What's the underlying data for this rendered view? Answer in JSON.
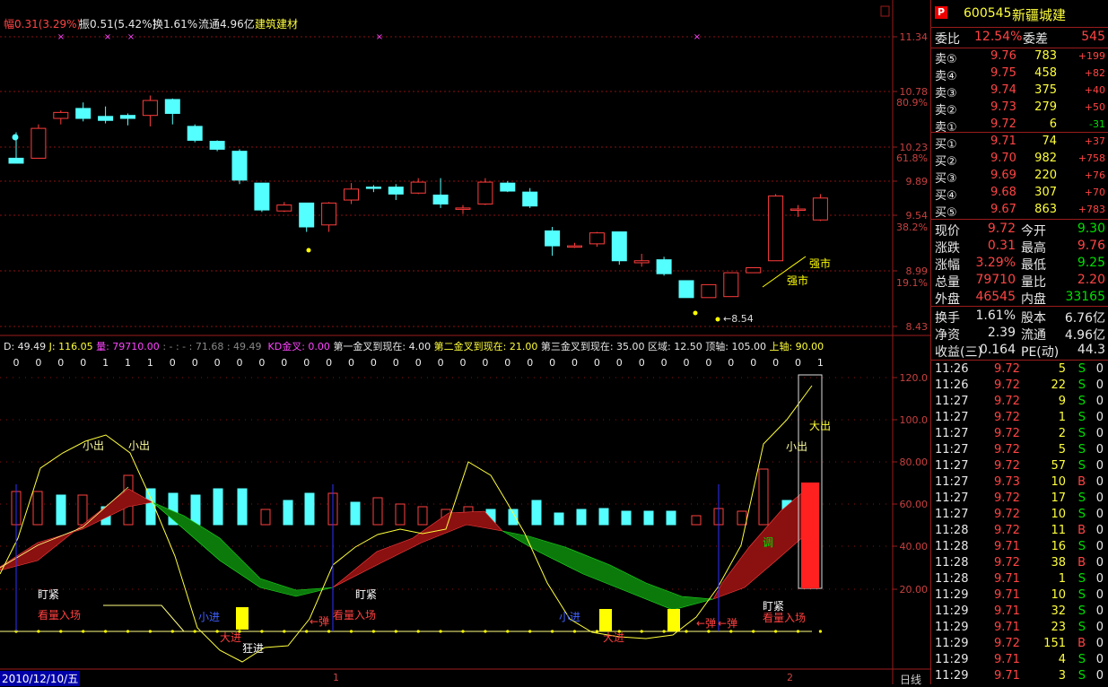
{
  "header": {
    "change": "幅0.31(3.29%)",
    "amplitude": "振0.51(5.42%)",
    "turnover": "换1.61%",
    "float_cap": "流通4.96亿",
    "sector": "建筑建材"
  },
  "price_axis": [
    "11.34",
    "10.78",
    "80.9%",
    "10.23",
    "61.8%",
    "9.89",
    "9.54",
    "38.2%",
    "8.99",
    "19.1%",
    "8.43"
  ],
  "candles": [
    [
      10.12,
      10.07,
      10.38,
      10.12
    ],
    [
      10.12,
      10.42,
      10.46,
      10.4
    ],
    [
      10.52,
      10.58,
      10.6,
      10.46
    ],
    [
      10.62,
      10.52,
      10.68,
      10.49
    ],
    [
      10.54,
      10.5,
      10.64,
      10.47
    ],
    [
      10.55,
      10.52,
      10.57,
      10.45
    ],
    [
      10.55,
      10.7,
      10.75,
      10.44
    ],
    [
      10.71,
      10.57,
      10.72,
      10.46
    ],
    [
      10.44,
      10.3,
      10.46,
      10.28
    ],
    [
      10.29,
      10.21,
      10.3,
      10.19
    ],
    [
      10.19,
      9.9,
      10.21,
      9.86
    ],
    [
      9.87,
      9.6,
      9.86,
      9.58
    ],
    [
      9.59,
      9.65,
      9.68,
      9.58
    ],
    [
      9.67,
      9.43,
      9.65,
      9.38
    ],
    [
      9.45,
      9.67,
      9.68,
      9.38
    ],
    [
      9.7,
      9.81,
      9.87,
      9.66
    ],
    [
      9.83,
      9.82,
      9.85,
      9.78
    ],
    [
      9.83,
      9.76,
      9.86,
      9.7
    ],
    [
      9.77,
      9.88,
      9.92,
      9.76
    ],
    [
      9.75,
      9.66,
      9.92,
      9.62
    ],
    [
      9.62,
      9.62,
      9.65,
      9.56
    ],
    [
      9.66,
      9.88,
      9.92,
      9.65
    ],
    [
      9.87,
      9.79,
      9.89,
      9.78
    ],
    [
      9.78,
      9.64,
      9.82,
      9.62
    ],
    [
      9.39,
      9.24,
      9.43,
      9.14
    ],
    [
      9.24,
      9.24,
      9.22,
      9.27
    ],
    [
      9.26,
      9.37,
      9.38,
      9.23
    ],
    [
      9.38,
      9.09,
      9.38,
      9.05
    ],
    [
      9.07,
      9.09,
      9.16,
      9.03
    ],
    [
      9.1,
      8.96,
      9.13,
      8.94
    ],
    [
      8.89,
      8.72,
      8.85,
      8.75
    ],
    [
      8.72,
      8.85,
      8.84,
      8.75
    ],
    [
      8.73,
      8.97,
      8.96,
      8.74
    ],
    [
      8.97,
      9.02,
      9.02,
      8.98
    ],
    [
      9.09,
      9.74,
      9.76,
      9.64
    ],
    [
      9.61,
      9.61,
      9.65,
      9.53
    ],
    [
      9.5,
      9.72,
      9.76,
      9.49
    ]
  ],
  "markers": {
    "low_label": "8.54",
    "strong1": "强市",
    "strong2": "强市"
  },
  "indicator": {
    "d": "D: 49.49",
    "j": "J: 116.05",
    "vol": "量: 79710.00",
    "seq": ": - : - : 71.68 : 49.49",
    "kd": "KD金叉: 0.00",
    "g1": "第一金叉到现在: 4.00",
    "g2": "第二金叉到现在: 21.00",
    "g3": "第三金叉到现在: 35.00",
    "zone": "区域: 12.50",
    "top": "顶轴: 105.00",
    "up": "上轴: 90.00"
  },
  "signal_digits": [
    "0",
    "0",
    "0",
    "0",
    "1",
    "1",
    "1",
    "0",
    "0",
    "0",
    "0",
    "0",
    "0",
    "0",
    "0",
    "0",
    "0",
    "0",
    "0",
    "0",
    "0",
    "0",
    "0",
    "0",
    "0",
    "0",
    "0",
    "0",
    "0",
    "0",
    "0",
    "0",
    "0",
    "0",
    "0",
    "0",
    "1"
  ],
  "osc_axis": [
    "120.0",
    "100.0",
    "80.00",
    "60.00",
    "40.00",
    "20.00"
  ],
  "osc_labels": {
    "small_out": "小出",
    "big_out": "大出",
    "tight": "盯紧",
    "watch": "看量入场",
    "small_in": "小进",
    "big_in": "大进",
    "crazy_in": "狂进",
    "rebound": "←弹",
    "adjust": "调"
  },
  "bottom": {
    "date": "2010/12/10/五",
    "tick1": "1",
    "tick2": "2",
    "period": "日线"
  },
  "panel": {
    "code": "600545",
    "name": "新疆城建",
    "wb_label": "委比",
    "wb_val": "12.54%",
    "wc_label": "委差",
    "wc_val": "545",
    "asks": [
      [
        "卖⑤",
        "9.76",
        "783",
        "+199"
      ],
      [
        "卖④",
        "9.75",
        "458",
        "+82"
      ],
      [
        "卖③",
        "9.74",
        "375",
        "+40"
      ],
      [
        "卖②",
        "9.73",
        "279",
        "+50"
      ],
      [
        "卖①",
        "9.72",
        "6",
        "-31"
      ]
    ],
    "bids": [
      [
        "买①",
        "9.71",
        "74",
        "+37"
      ],
      [
        "买②",
        "9.70",
        "982",
        "+758"
      ],
      [
        "买③",
        "9.69",
        "220",
        "+76"
      ],
      [
        "买④",
        "9.68",
        "307",
        "+70"
      ],
      [
        "买⑤",
        "9.67",
        "863",
        "+783"
      ]
    ],
    "quote": [
      [
        "现价",
        "9.72",
        "今开",
        "9.30"
      ],
      [
        "涨跌",
        "0.31",
        "最高",
        "9.76"
      ],
      [
        "涨幅",
        "3.29%",
        "最低",
        "9.25"
      ],
      [
        "总量",
        "79710",
        "量比",
        "2.20"
      ],
      [
        "外盘",
        "46545",
        "内盘",
        "33165"
      ]
    ],
    "fin": [
      [
        "换手",
        "1.61%",
        "股本",
        "6.76亿"
      ],
      [
        "净资",
        "2.39",
        "流通",
        "4.96亿"
      ],
      [
        "收益(三)",
        "0.164",
        "PE(动)",
        "44.3"
      ]
    ],
    "ticks": [
      [
        "11:26",
        "9.72",
        "5",
        "S"
      ],
      [
        "11:26",
        "9.72",
        "22",
        "S"
      ],
      [
        "11:27",
        "9.72",
        "9",
        "S"
      ],
      [
        "11:27",
        "9.72",
        "1",
        "S"
      ],
      [
        "11:27",
        "9.72",
        "2",
        "S"
      ],
      [
        "11:27",
        "9.72",
        "5",
        "S"
      ],
      [
        "11:27",
        "9.72",
        "57",
        "S"
      ],
      [
        "11:27",
        "9.73",
        "10",
        "B"
      ],
      [
        "11:27",
        "9.72",
        "17",
        "S"
      ],
      [
        "11:27",
        "9.72",
        "10",
        "S"
      ],
      [
        "11:28",
        "9.72",
        "11",
        "B"
      ],
      [
        "11:28",
        "9.71",
        "16",
        "S"
      ],
      [
        "11:28",
        "9.72",
        "38",
        "B"
      ],
      [
        "11:28",
        "9.71",
        "1",
        "S"
      ],
      [
        "11:29",
        "9.71",
        "10",
        "S"
      ],
      [
        "11:29",
        "9.71",
        "32",
        "S"
      ],
      [
        "11:29",
        "9.71",
        "23",
        "S"
      ],
      [
        "11:29",
        "9.72",
        "151",
        "B"
      ],
      [
        "11:29",
        "9.71",
        "4",
        "S"
      ],
      [
        "11:29",
        "9.71",
        "3",
        "S"
      ]
    ],
    "tick_tail": [
      "0",
      "0",
      "0",
      "0",
      "0",
      "0",
      "0",
      "0",
      "0",
      "0",
      "0",
      "0",
      "0",
      "0",
      "0",
      "0",
      "0",
      "0",
      "0",
      "0"
    ]
  }
}
